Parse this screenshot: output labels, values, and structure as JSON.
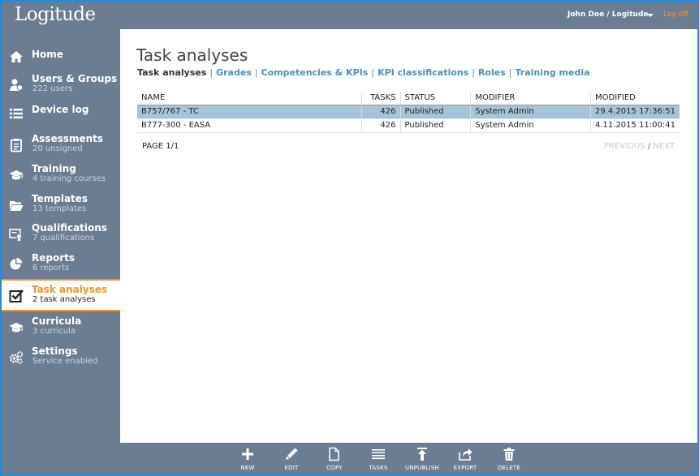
{
  "app": {
    "logo": "Logitude"
  },
  "header": {
    "user": "John Doe / Logitude",
    "logoff": "Log off"
  },
  "sidebar": {
    "items": [
      {
        "label": "Home",
        "sub": "",
        "icon": "home-icon"
      },
      {
        "label": "Users & Groups",
        "sub": "222 users",
        "icon": "users-icon"
      },
      {
        "label": "Device log",
        "sub": "",
        "icon": "list-icon"
      },
      {
        "label": "Assessments",
        "sub": "20 unsigned",
        "icon": "clipboard-icon"
      },
      {
        "label": "Training",
        "sub": "4 training courses",
        "icon": "graduation-cap-icon"
      },
      {
        "label": "Templates",
        "sub": "13 templates",
        "icon": "folder-icon"
      },
      {
        "label": "Qualifications",
        "sub": "7 qualifications",
        "icon": "certificate-icon"
      },
      {
        "label": "Reports",
        "sub": "6 reports",
        "icon": "pie-chart-icon"
      },
      {
        "label": "Task analyses",
        "sub": "2 task analyses",
        "icon": "checkbox-icon",
        "active": true
      },
      {
        "label": "Curricula",
        "sub": "3 curricula",
        "icon": "graduation-cap-icon"
      },
      {
        "label": "Settings",
        "sub": "Service enabled",
        "icon": "gears-icon"
      }
    ]
  },
  "main": {
    "title": "Task analyses",
    "tabs": [
      {
        "label": "Task analyses",
        "active": true
      },
      {
        "label": "Grades"
      },
      {
        "label": "Competencies & KPIs"
      },
      {
        "label": "KPI classifications"
      },
      {
        "label": "Roles"
      },
      {
        "label": "Training media"
      }
    ],
    "table": {
      "columns": [
        "NAME",
        "TASKS",
        "STATUS",
        "MODIFIER",
        "MODIFIED"
      ],
      "rows": [
        {
          "name": "B757/767 - TC",
          "tasks": "426",
          "status": "Published",
          "modifier": "System Admin",
          "modified": "29.4.2015 17:36:51",
          "selected": true
        },
        {
          "name": "B777-300 - EASA",
          "tasks": "426",
          "status": "Published",
          "modifier": "System Admin",
          "modified": "4.11.2015 11:00:41"
        }
      ]
    },
    "pager": {
      "page": "PAGE 1/1",
      "previous": "PREVIOUS",
      "separator": "/",
      "next": "NEXT"
    }
  },
  "toolbar": {
    "buttons": [
      {
        "label": "NEW",
        "icon": "plus-icon"
      },
      {
        "label": "EDIT",
        "icon": "pencil-icon"
      },
      {
        "label": "COPY",
        "icon": "copy-icon"
      },
      {
        "label": "TASKS",
        "icon": "tasks-icon"
      },
      {
        "label": "UNPUBLISH",
        "icon": "unpublish-icon"
      },
      {
        "label": "EXPORT",
        "icon": "export-icon"
      },
      {
        "label": "DELETE",
        "icon": "trash-icon"
      }
    ]
  },
  "colors": {
    "accent": "#f7941d",
    "chrome": "#6c7d92",
    "link": "#4a90b8",
    "selected_row": "#a7c3d8",
    "frame": "#1e8de0"
  }
}
